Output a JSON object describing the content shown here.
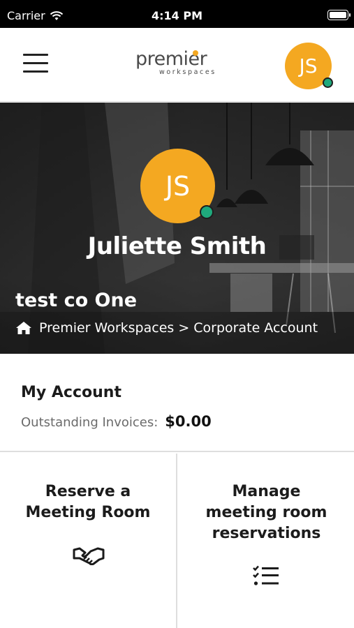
{
  "status_bar": {
    "carrier": "Carrier",
    "time": "4:14 PM"
  },
  "header": {
    "logo_text": "premier",
    "logo_subtext": "workspaces",
    "avatar_initials": "JS"
  },
  "profile": {
    "initials": "JS",
    "name": "Juliette Smith",
    "company": "test co One",
    "breadcrumb": "Premier Workspaces > Corporate Account"
  },
  "account": {
    "title": "My Account",
    "invoices_label": "Outstanding Invoices:",
    "invoices_value": "$0.00"
  },
  "tiles": [
    {
      "label": "Reserve a Meeting Room",
      "icon": "handshake-icon"
    },
    {
      "label": "Manage meeting room reservations",
      "icon": "checklist-icon"
    }
  ],
  "colors": {
    "accent": "#f4a821",
    "presence": "#1fa97c"
  }
}
